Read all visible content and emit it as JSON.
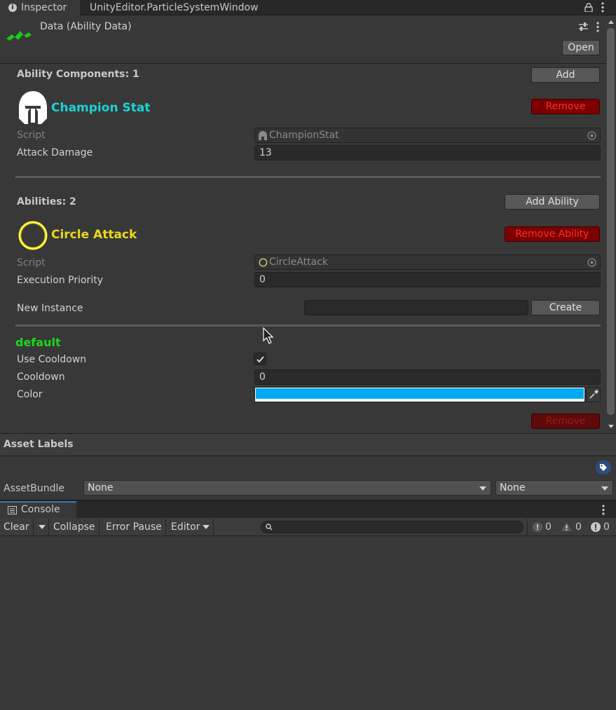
{
  "tabs": [
    {
      "label": "Inspector"
    },
    {
      "label": "UnityEditor.ParticleSystemWindow"
    }
  ],
  "header": {
    "title": "Data (Ability Data)",
    "open_label": "Open"
  },
  "ability_components": {
    "heading": "Ability Components: 1",
    "add_label": "Add",
    "component": {
      "name": "Champion Stat",
      "name_color": "#1ad4d4",
      "remove_label": "Remove",
      "script_label": "Script",
      "script_value": "ChampionStat",
      "field_label": "Attack Damage",
      "field_value": "13"
    }
  },
  "abilities": {
    "heading": "Abilities: 2",
    "add_label": "Add Ability",
    "ability": {
      "name": "Circle Attack",
      "name_color": "#e8d817",
      "remove_label": "Remove Ability",
      "script_label": "Script",
      "script_value": "CircleAttack",
      "priority_label": "Execution Priority",
      "priority_value": "0",
      "instance_label": "New Instance",
      "instance_value": "",
      "create_label": "Create"
    }
  },
  "default_section": {
    "heading": "default",
    "heading_color": "#19d919",
    "use_cooldown_label": "Use Cooldown",
    "use_cooldown_checked": true,
    "cooldown_label": "Cooldown",
    "cooldown_value": "0",
    "color_label": "Color",
    "color_value": "#00aaf0",
    "remove_label": "Remove"
  },
  "asset_labels": {
    "heading": "Asset Labels",
    "bundle_label": "AssetBundle",
    "bundle_value": "None",
    "variant_value": "None"
  },
  "console": {
    "tab_label": "Console",
    "clear_label": "Clear",
    "collapse_label": "Collapse",
    "error_pause_label": "Error Pause",
    "editor_label": "Editor",
    "search_value": "",
    "info_count": "0",
    "warning_count": "0",
    "error_count": "0"
  },
  "icons": [
    "info-icon",
    "lock-icon",
    "kebab-menu-icon",
    "ability-data-icon",
    "settings-sliders-icon",
    "helmet-icon",
    "ring-icon",
    "object-picker-icon",
    "eyedropper-icon",
    "tag-icon",
    "console-icon",
    "search-icon"
  ]
}
